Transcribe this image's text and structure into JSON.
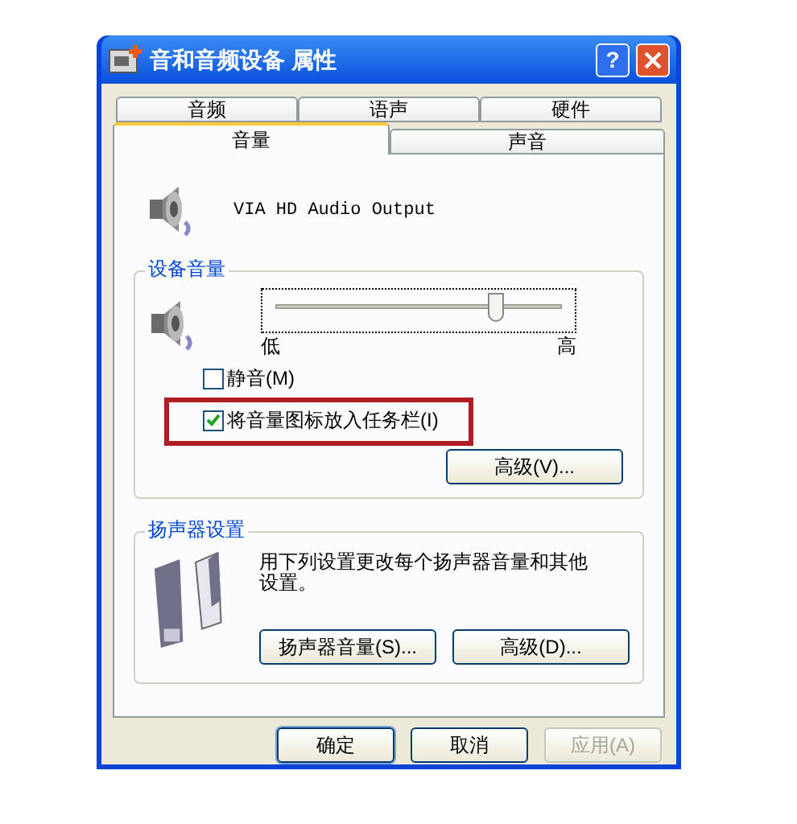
{
  "window": {
    "title": "音和音频设备 属性",
    "help_button": "?"
  },
  "tab_rows": [
    {
      "tabs": [
        {
          "label": "音频",
          "selected": false
        },
        {
          "label": "语声",
          "selected": false
        },
        {
          "label": "硬件",
          "selected": false
        }
      ]
    },
    {
      "tabs": [
        {
          "label": "音量",
          "selected": true
        },
        {
          "label": "声音",
          "selected": false
        }
      ]
    }
  ],
  "device": {
    "name": "VIA HD Audio Output"
  },
  "device_volume": {
    "title": "设备音量",
    "slider": {
      "level": 0.77,
      "low": "低",
      "high": "高"
    },
    "checkboxes": [
      {
        "label": "静音(M)",
        "checked": false,
        "highlighted": false
      },
      {
        "label": "将音量图标放入任务栏(I)",
        "checked": true,
        "highlighted": true
      }
    ],
    "button": "高级(V)..."
  },
  "speaker_settings": {
    "title": "扬声器设置",
    "description": "用下列设置更改每个扬声器音量和其他设置。",
    "buttons": [
      "扬声器音量(S)...",
      "高级(D)..."
    ]
  },
  "buttons": [
    {
      "label": "确定",
      "disabled": false,
      "default": true
    },
    {
      "label": "取消",
      "disabled": false,
      "default": false
    },
    {
      "label": "应用(A)",
      "disabled": true,
      "default": false
    }
  ]
}
